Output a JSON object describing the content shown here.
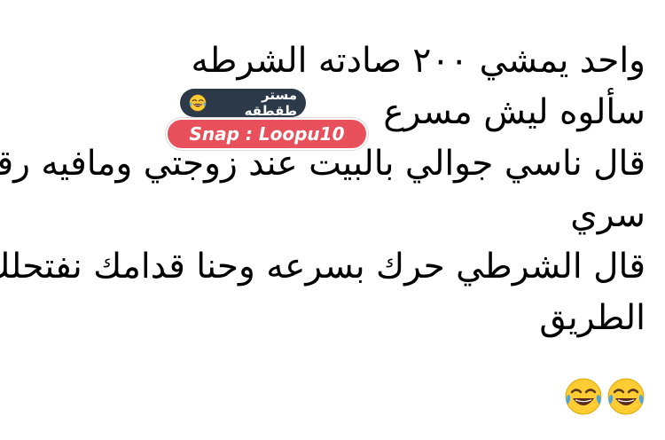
{
  "post": {
    "lines": [
      "واحد يمشي ٢٠٠ صادته الشرطه",
      "سألوه ليش مسرع",
      "قال ناسي جوالي  بالبيت عند زوجتي ومافيه رقم",
      "سري",
      "قال الشرطي حرك بسرعه وحنا قدامك نفتحلك",
      "الطريق"
    ],
    "emojis": [
      "face-with-tears-of-joy-icon",
      "face-with-tears-of-joy-icon"
    ]
  },
  "watermark": {
    "account_name": "مستر طقطقه",
    "account_emoji": "face-with-tears-of-joy-icon",
    "snap_label": "Snap : Loopu10"
  },
  "colors": {
    "background": "#ffffff",
    "text": "#000000",
    "watermark_dark": "#2b3948",
    "watermark_red": "#e8505b",
    "emoji_face": "#ffcc33"
  }
}
